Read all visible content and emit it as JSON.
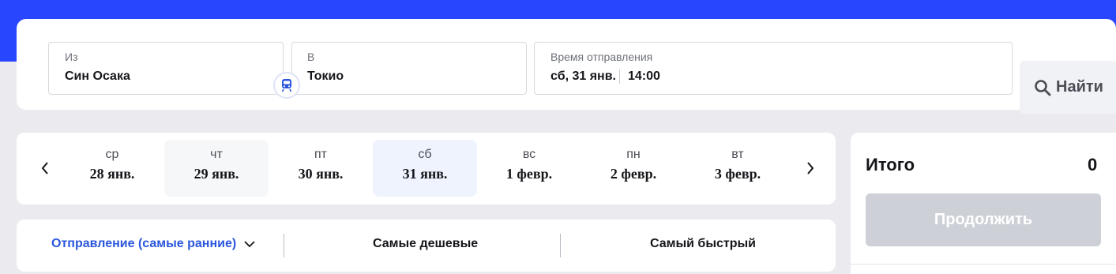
{
  "search": {
    "from_label": "Из",
    "from_value": "Син Осака",
    "to_label": "В",
    "to_value": "Токио",
    "time_label": "Время отправления",
    "time_date": "сб, 31 янв.",
    "time_hour": "14:00",
    "search_button": "Найти"
  },
  "dates": [
    {
      "dow": "ср",
      "date": "28 янв."
    },
    {
      "dow": "чт",
      "date": "29 янв."
    },
    {
      "dow": "пт",
      "date": "30 янв."
    },
    {
      "dow": "сб",
      "date": "31 янв.",
      "selected": true
    },
    {
      "dow": "вс",
      "date": "1 февр."
    },
    {
      "dow": "пн",
      "date": "2 февр."
    },
    {
      "dow": "вт",
      "date": "3 февр."
    }
  ],
  "sort": {
    "active": "Отправление (самые ранние)",
    "cheapest": "Самые дешевые",
    "fastest": "Самый быстрый"
  },
  "summary": {
    "total_label": "Итого",
    "total_value": "0",
    "continue_button": "Продолжить"
  },
  "colors": {
    "brand": "#2946ff",
    "accent_text": "#2a56dd",
    "disabled_button": "#cdd0d6",
    "selected_day": "#eef3fd"
  }
}
